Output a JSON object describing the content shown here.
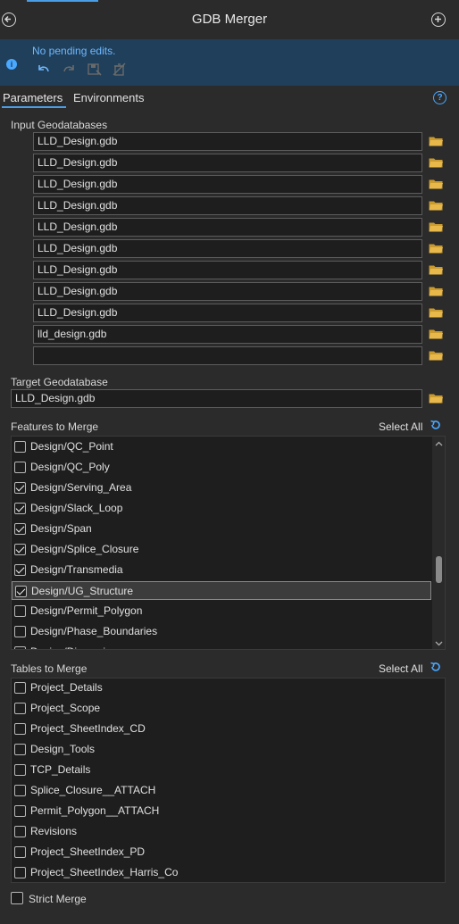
{
  "window": {
    "title": "GDB Merger"
  },
  "edits": {
    "status": "No pending edits."
  },
  "tabs": [
    {
      "label": "Parameters"
    },
    {
      "label": "Environments"
    }
  ],
  "input_gdbs": {
    "label": "Input Geodatabases",
    "values": [
      "LLD_Design.gdb",
      "LLD_Design.gdb",
      "LLD_Design.gdb",
      "LLD_Design.gdb",
      "LLD_Design.gdb",
      "LLD_Design.gdb",
      "LLD_Design.gdb",
      "LLD_Design.gdb",
      "LLD_Design.gdb",
      "lld_design.gdb",
      ""
    ]
  },
  "target_gdb": {
    "label": "Target Geodatabase",
    "value": "LLD_Design.gdb"
  },
  "features": {
    "label": "Features to Merge",
    "select_all": "Select All",
    "items": [
      {
        "name": "Design/QC_Point",
        "checked": false
      },
      {
        "name": "Design/QC_Poly",
        "checked": false
      },
      {
        "name": "Design/Serving_Area",
        "checked": true
      },
      {
        "name": "Design/Slack_Loop",
        "checked": true
      },
      {
        "name": "Design/Span",
        "checked": true
      },
      {
        "name": "Design/Splice_Closure",
        "checked": true
      },
      {
        "name": "Design/Transmedia",
        "checked": true
      },
      {
        "name": "Design/UG_Structure",
        "checked": true,
        "selected": true
      },
      {
        "name": "Design/Permit_Polygon",
        "checked": false
      },
      {
        "name": "Design/Phase_Boundaries",
        "checked": false
      },
      {
        "name": "Design/Dimensions",
        "checked": false
      }
    ]
  },
  "tables": {
    "label": "Tables to Merge",
    "select_all": "Select All",
    "items": [
      {
        "name": "Project_Details",
        "checked": false
      },
      {
        "name": "Project_Scope",
        "checked": false
      },
      {
        "name": "Project_SheetIndex_CD",
        "checked": false
      },
      {
        "name": "Design_Tools",
        "checked": false
      },
      {
        "name": "TCP_Details",
        "checked": false
      },
      {
        "name": "Splice_Closure__ATTACH",
        "checked": false
      },
      {
        "name": "Permit_Polygon__ATTACH",
        "checked": false
      },
      {
        "name": "Revisions",
        "checked": false
      },
      {
        "name": "Project_SheetIndex_PD",
        "checked": false
      },
      {
        "name": "Project_SheetIndex_Harris_Co",
        "checked": false
      }
    ]
  },
  "strict_merge": {
    "label": "Strict Merge",
    "checked": false
  },
  "colors": {
    "accent": "#4a9ee8",
    "edit_bar": "#1f3f5a",
    "folder": "#e8b84a"
  }
}
